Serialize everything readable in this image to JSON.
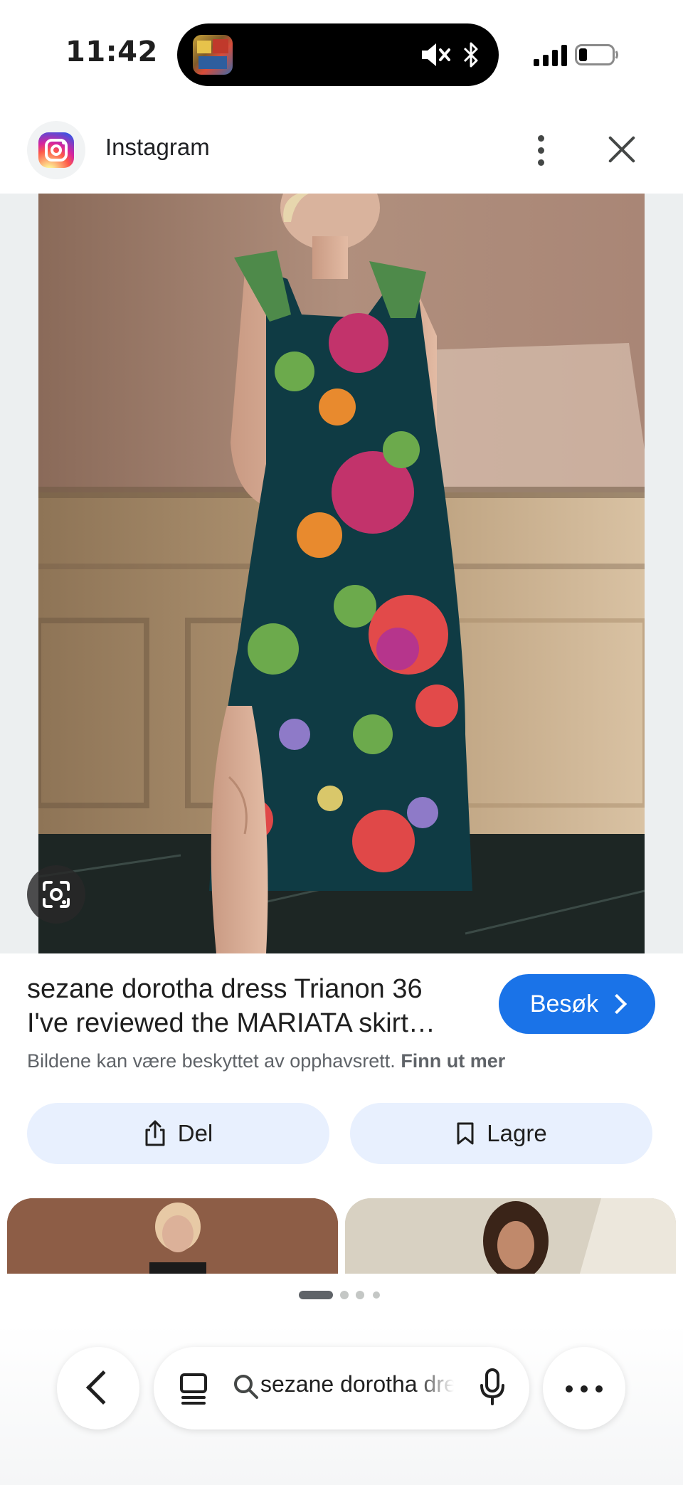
{
  "status_bar": {
    "time": "11:42"
  },
  "source": {
    "name": "Instagram"
  },
  "result": {
    "title_line1": "sezane dorotha dress Trianon 36",
    "title_line2": "I've reviewed the MARIATA skirt…",
    "visit_label": "Besøk",
    "copyright_text": "Bildene kan være beskyttet av opphavsrett.",
    "copyright_link": "Finn ut mer"
  },
  "actions": {
    "share_label": "Del",
    "save_label": "Lagre"
  },
  "carousel": {
    "page_count": 4,
    "active_index": 0
  },
  "bottom_bar": {
    "search_query": "sezane dorotha dress"
  },
  "colors": {
    "accent": "#1a73e8",
    "pill_background": "#e8f0fe",
    "icon": "#444746"
  },
  "icons": [
    "dynamic-island-app-icon",
    "mute-icon",
    "bluetooth-icon",
    "signal-icon",
    "battery-icon",
    "instagram-logo-icon",
    "more-vert-icon",
    "close-icon",
    "google-lens-icon",
    "chevron-right-icon",
    "share-icon",
    "bookmark-icon",
    "back-chevron-icon",
    "tabs-icon",
    "search-icon",
    "mic-icon",
    "more-horiz-icon"
  ]
}
